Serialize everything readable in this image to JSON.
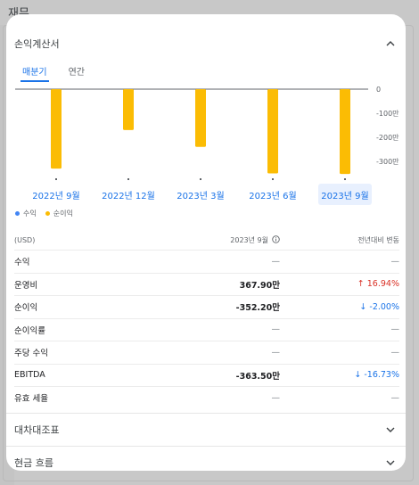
{
  "page": {
    "title": "재무"
  },
  "income": {
    "title": "손익계산서",
    "tabs": [
      "매분기",
      "연간"
    ],
    "y_ticks": [
      "0",
      "-100만",
      "-200만",
      "-300만"
    ],
    "legend": [
      "수익",
      "순이익"
    ],
    "chart_data": {
      "type": "bar",
      "categories": [
        "2022년 9월",
        "2022년 12월",
        "2023년 3월",
        "2023년 6월",
        "2023년 9월"
      ],
      "series": [
        {
          "name": "수익",
          "values": [
            0,
            0,
            0,
            0,
            0
          ]
        },
        {
          "name": "순이익",
          "values": [
            -3300000,
            -1700000,
            -2400000,
            -3500000,
            -3522000
          ]
        }
      ],
      "ylim": [
        -3600000,
        0
      ],
      "selected": "2023년 9월"
    },
    "table": {
      "unit": "(USD)",
      "period": "2023년 9월",
      "change_header": "전년대비 변동",
      "rows": [
        {
          "label": "수익",
          "value": "—",
          "change": "—",
          "dir": ""
        },
        {
          "label": "운영비",
          "value": "367.90만",
          "change": "16.94%",
          "dir": "up"
        },
        {
          "label": "순이익",
          "value": "-352.20만",
          "change": "-2.00%",
          "dir": "down"
        },
        {
          "label": "순이익률",
          "value": "—",
          "change": "—",
          "dir": ""
        },
        {
          "label": "주당 수익",
          "value": "—",
          "change": "—",
          "dir": ""
        },
        {
          "label": "EBITDA",
          "value": "-363.50만",
          "change": "-16.73%",
          "dir": "down"
        },
        {
          "label": "유효 세율",
          "value": "—",
          "change": "—",
          "dir": ""
        }
      ]
    }
  },
  "balance": {
    "title": "대차대조표"
  },
  "cashflow": {
    "title": "현금 흐름"
  },
  "colors": {
    "revenue": "#4285f4",
    "net_income": "#fbbc04",
    "accent": "#1a73e8",
    "up": "#d93025"
  },
  "icons": {
    "collapse": "chevron-up-icon",
    "expand": "chevron-down-icon",
    "info": "info-icon",
    "up": "arrow-up-icon",
    "down": "arrow-down-icon"
  }
}
